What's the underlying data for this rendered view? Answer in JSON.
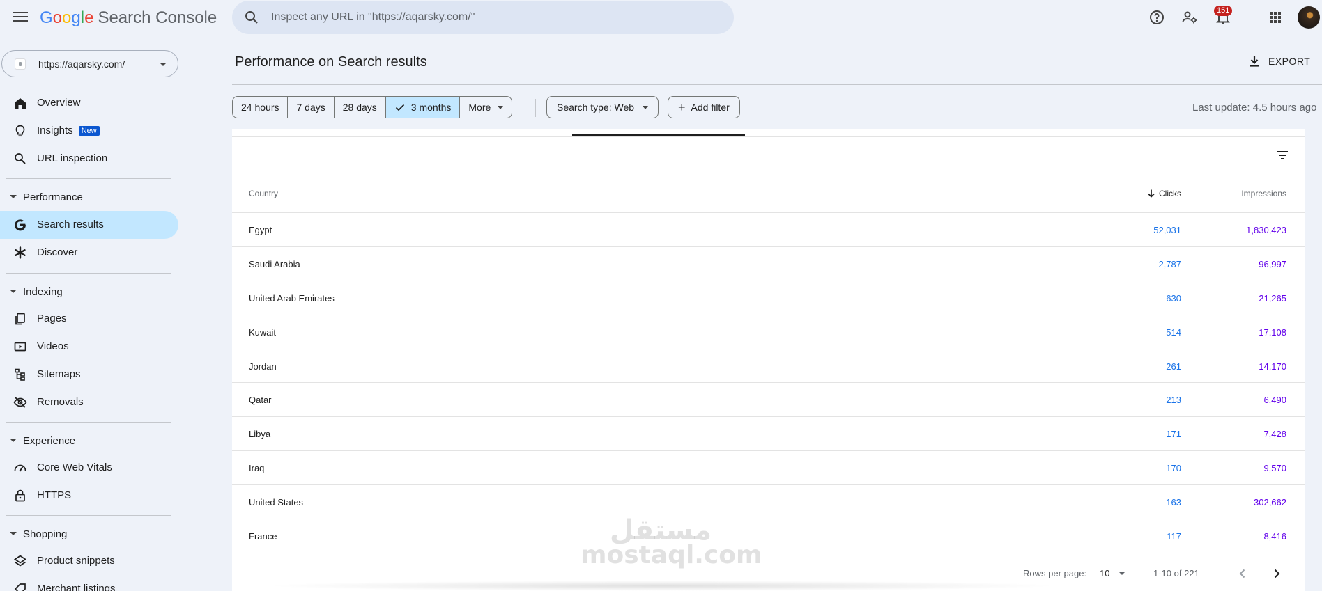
{
  "app": {
    "brand_google": [
      "G",
      "o",
      "o",
      "g",
      "l",
      "e"
    ],
    "brand_colors": [
      "#4285F4",
      "#EA4335",
      "#FBBC05",
      "#4285F4",
      "#34A853",
      "#EA4335"
    ],
    "product_name": "Search Console"
  },
  "search": {
    "placeholder": "Inspect any URL in \"https://aqarsky.com/\""
  },
  "topbar": {
    "notifications_count": "151"
  },
  "property": {
    "label": "https://aqarsky.com/"
  },
  "sidebar": {
    "overview": "Overview",
    "insights": "Insights",
    "insights_badge": "New",
    "url_inspection": "URL inspection",
    "performance_head": "Performance",
    "search_results": "Search results",
    "discover": "Discover",
    "indexing_head": "Indexing",
    "pages": "Pages",
    "videos": "Videos",
    "sitemaps": "Sitemaps",
    "removals": "Removals",
    "experience_head": "Experience",
    "core_web_vitals": "Core Web Vitals",
    "https": "HTTPS",
    "shopping_head": "Shopping",
    "product_snippets": "Product snippets",
    "merchant_listings": "Merchant listings"
  },
  "main": {
    "title": "Performance on Search results",
    "export_label": "EXPORT",
    "date_chips": [
      "24 hours",
      "7 days",
      "28 days",
      "3 months",
      "More"
    ],
    "selected_chip": "3 months",
    "search_type": "Search type: Web",
    "add_filter": "Add filter",
    "last_update": "Last update: 4.5 hours ago"
  },
  "table": {
    "col_country": "Country",
    "col_clicks": "Clicks",
    "col_impressions": "Impressions",
    "rows": [
      {
        "country": "Egypt",
        "clicks": "52,031",
        "impressions": "1,830,423"
      },
      {
        "country": "Saudi Arabia",
        "clicks": "2,787",
        "impressions": "96,997"
      },
      {
        "country": "United Arab Emirates",
        "clicks": "630",
        "impressions": "21,265"
      },
      {
        "country": "Kuwait",
        "clicks": "514",
        "impressions": "17,108"
      },
      {
        "country": "Jordan",
        "clicks": "261",
        "impressions": "14,170"
      },
      {
        "country": "Qatar",
        "clicks": "213",
        "impressions": "6,490"
      },
      {
        "country": "Libya",
        "clicks": "171",
        "impressions": "7,428"
      },
      {
        "country": "Iraq",
        "clicks": "170",
        "impressions": "9,570"
      },
      {
        "country": "United States",
        "clicks": "163",
        "impressions": "302,662"
      },
      {
        "country": "France",
        "clicks": "117",
        "impressions": "8,416"
      }
    ],
    "rows_per_page_label": "Rows per page:",
    "rows_per_page": "10",
    "range": "1-10 of 221"
  },
  "watermark": {
    "arabic": "مستقل",
    "latin": "mostaql.com"
  },
  "colors": {
    "accent": "#c2e7ff",
    "clicks": "#1a73e8",
    "impressions": "#6200ea",
    "badge": "#c5221f"
  }
}
